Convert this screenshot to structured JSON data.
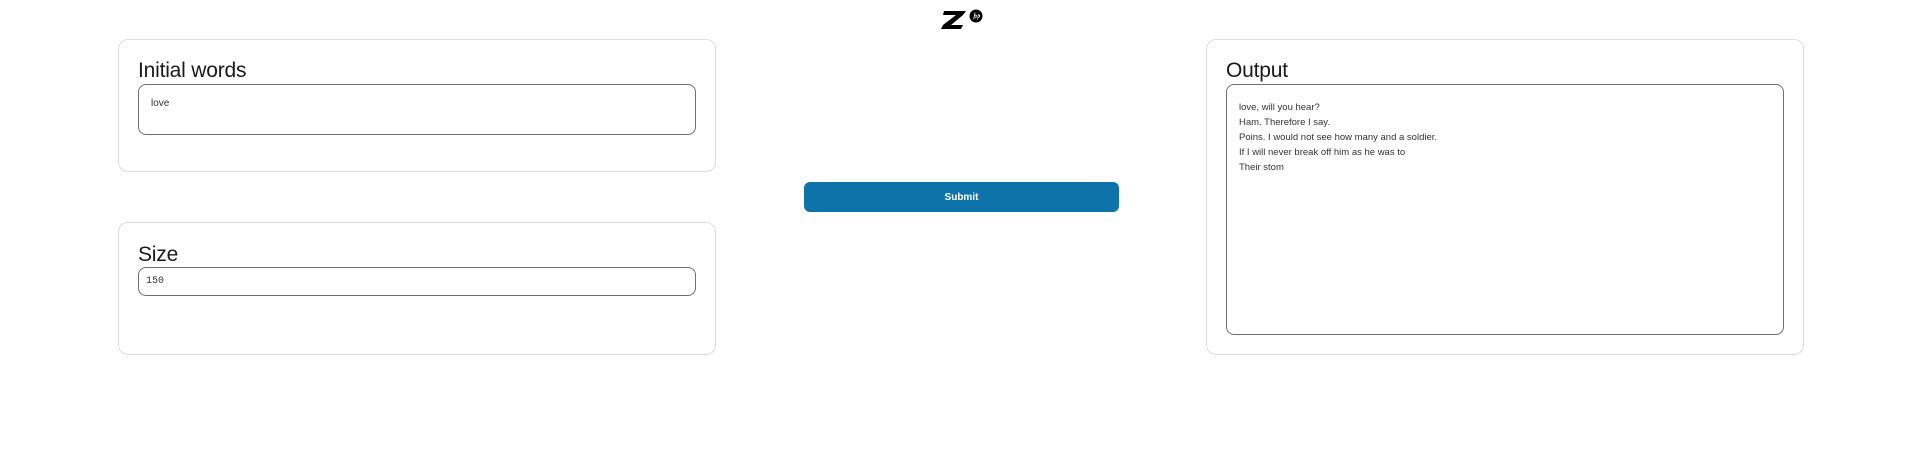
{
  "initial_words": {
    "label": "Initial words",
    "value": "love"
  },
  "size": {
    "label": "Size",
    "value": "150"
  },
  "submit": {
    "label": "Submit"
  },
  "output": {
    "label": "Output",
    "lines": [
      "love, will you hear?",
      "Ham. Therefore I say.",
      "Poins. I would not see how many and a soldier.",
      "If I will never break off him as he was to",
      "Their stom"
    ]
  },
  "colors": {
    "accent": "#0d73a8",
    "logo": "#000000"
  },
  "logo": {
    "icon": "z-by-hp-logo"
  }
}
